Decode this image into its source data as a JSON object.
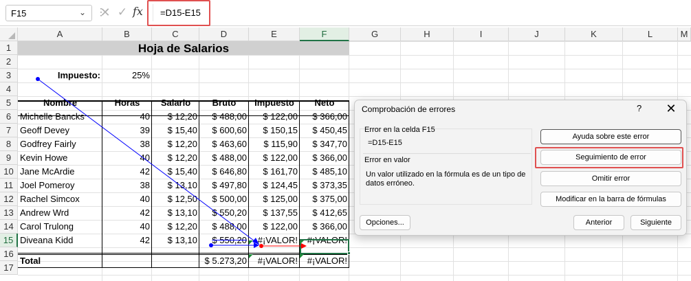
{
  "formula_bar": {
    "name_box": "F15",
    "formula": "=D15-E15",
    "cancel_glyph": "✕",
    "enter_glyph": "✓",
    "fx_label": "fx"
  },
  "columns": [
    "A",
    "B",
    "C",
    "D",
    "E",
    "F",
    "G",
    "H",
    "I",
    "J",
    "K",
    "L",
    "M"
  ],
  "rows": [
    "1",
    "2",
    "3",
    "4",
    "5",
    "6",
    "7",
    "8",
    "9",
    "10",
    "11",
    "12",
    "13",
    "14",
    "15",
    "16",
    "17"
  ],
  "sheet": {
    "title": "Hoja de Salarios",
    "tax_label": "Impuesto:",
    "tax_value": "25%",
    "headers": [
      "Nombre",
      "Horas",
      "Salario",
      "Bruto",
      "Impuesto",
      "Neto"
    ],
    "employees": [
      [
        "Michelle Bancks",
        "40",
        "$ 12,20",
        "$ 488,00",
        "$ 122,00",
        "$ 366,00"
      ],
      [
        "Geoff Devey",
        "39",
        "$ 15,40",
        "$ 600,60",
        "$ 150,15",
        "$ 450,45"
      ],
      [
        "Godfrey Fairly",
        "38",
        "$ 12,20",
        "$ 463,60",
        "$ 115,90",
        "$ 347,70"
      ],
      [
        "Kevin Howe",
        "40",
        "$ 12,20",
        "$ 488,00",
        "$ 122,00",
        "$ 366,00"
      ],
      [
        "Jane McArdie",
        "42",
        "$ 15,40",
        "$ 646,80",
        "$ 161,70",
        "$ 485,10"
      ],
      [
        "Joel Pomeroy",
        "38",
        "$ 13,10",
        "$ 497,80",
        "$ 124,45",
        "$ 373,35"
      ],
      [
        "Rachel Simcox",
        "40",
        "$ 12,50",
        "$ 500,00",
        "$ 125,00",
        "$ 375,00"
      ],
      [
        "Andrew Wrd",
        "42",
        "$ 13,10",
        "$ 550,20",
        "$ 137,55",
        "$ 412,65"
      ],
      [
        "Carol Trulong",
        "40",
        "$ 12,20",
        "$ 488,00",
        "$ 122,00",
        "$ 366,00"
      ],
      [
        "Diveana Kidd",
        "42",
        "$ 13,10",
        "$ 550,20",
        "#¡VALOR!",
        "#¡VALOR!"
      ]
    ],
    "total_label": "Total",
    "total_bruto": "$ 5.273,20",
    "total_impuesto": "#¡VALOR!",
    "total_neto": "#¡VALOR!"
  },
  "dialog": {
    "title": "Comprobación de errores",
    "help": "?",
    "close": "✕",
    "cell_label": "Error en la celda F15",
    "cell_formula": "=D15-E15",
    "error_type": "Error en valor",
    "error_description": "Un valor utilizado en la fórmula es de un tipo de datos erróneo.",
    "buttons": {
      "help_error": "Ayuda sobre este error",
      "trace_error": "Seguimiento de error",
      "ignore_error": "Omitir error",
      "edit_formula_bar": "Modificar en la barra de fórmulas",
      "options": "Opciones...",
      "previous": "Anterior",
      "next": "Siguiente"
    }
  },
  "colors": {
    "accent_green": "#217346",
    "highlight_red": "#e05050",
    "trace_blue": "#0000ff",
    "trace_red": "#ff0000"
  }
}
